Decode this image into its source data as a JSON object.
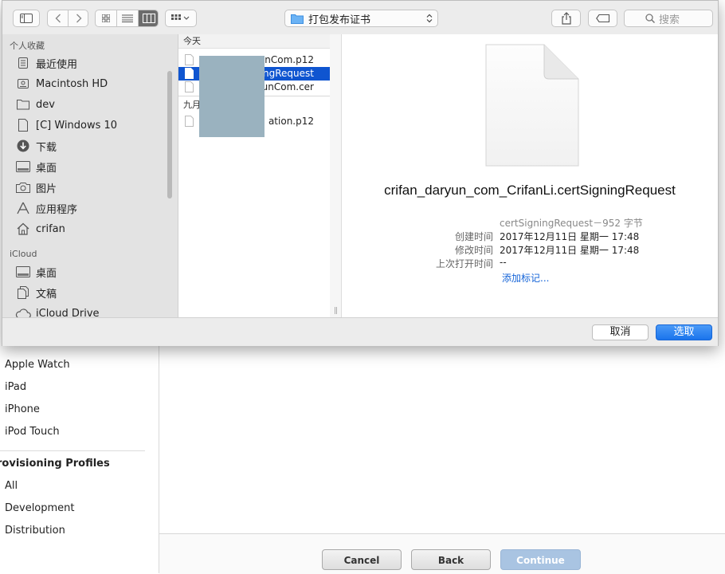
{
  "background_page": {
    "sidebar": {
      "items": [
        "Apple Watch",
        "iPad",
        "iPhone",
        "iPod Touch"
      ],
      "section_heading": "rovisioning Profiles",
      "profile_items": [
        "All",
        "Development",
        "Distribution"
      ]
    },
    "footer_buttons": {
      "cancel": "Cancel",
      "back": "Back",
      "continue": "Continue"
    }
  },
  "dialog": {
    "toolbar": {
      "path": "打包发布证书",
      "search_placeholder": "搜索"
    },
    "sidebar": {
      "favorites_heading": "个人收藏",
      "favorites": [
        {
          "label": "最近使用",
          "icon": "recents-icon"
        },
        {
          "label": "Macintosh HD",
          "icon": "hard-drive-icon"
        },
        {
          "label": "dev",
          "icon": "folder-icon"
        },
        {
          "label": "[C] Windows 10",
          "icon": "document-icon"
        },
        {
          "label": "下载",
          "icon": "download-icon"
        },
        {
          "label": "桌面",
          "icon": "desktop-icon"
        },
        {
          "label": "图片",
          "icon": "camera-icon"
        },
        {
          "label": "应用程序",
          "icon": "applications-icon"
        },
        {
          "label": "crifan",
          "icon": "home-icon"
        }
      ],
      "icloud_heading": "iCloud",
      "icloud": [
        {
          "label": "桌面",
          "icon": "desktop-icon"
        },
        {
          "label": "文稿",
          "icon": "documents-icon"
        },
        {
          "label": "iCloud Drive",
          "icon": "cloud-icon"
        }
      ]
    },
    "file_column": {
      "group_today": "今天",
      "group_september": "九月",
      "files": [
        {
          "name": "unCom.p12",
          "selected": false
        },
        {
          "name": "ingRequest",
          "selected": true
        },
        {
          "name": "unCom.cer",
          "selected": false
        },
        {
          "name": "ation.p12",
          "selected": false
        }
      ]
    },
    "preview": {
      "filename": "crifan_daryun_com_CrifanLi.certSigningRequest",
      "kind_size": "certSigningRequest－952 字节",
      "created_label": "创建时间",
      "created_value": "2017年12月11日 星期一 17:48",
      "modified_label": "修改时间",
      "modified_value": "2017年12月11日 星期一 17:48",
      "last_opened_label": "上次打开时间",
      "last_opened_value": "--",
      "add_tags": "添加标记..."
    },
    "buttons": {
      "cancel": "取消",
      "choose": "选取"
    }
  }
}
